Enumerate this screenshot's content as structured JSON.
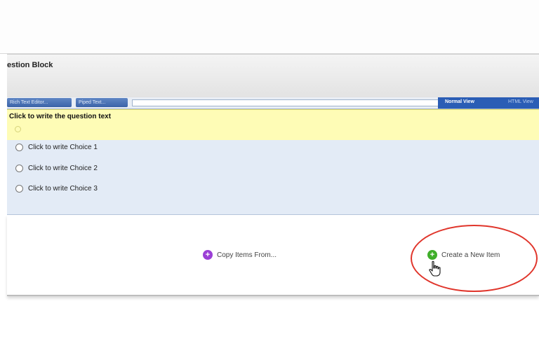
{
  "block": {
    "title": "estion Block"
  },
  "toolbar": {
    "rich_text_editor_label": "Rich Text Editor...",
    "piped_text_label": "Piped Text...",
    "normal_view_label": "Normal View",
    "html_view_label": "HTML View"
  },
  "question": {
    "prompt": "Click to write the question text",
    "choices": [
      {
        "label": "Click to write Choice 1"
      },
      {
        "label": "Click to write Choice 2"
      },
      {
        "label": "Click to write Choice 3"
      }
    ]
  },
  "actions": {
    "copy_items_label": "Copy Items From...",
    "create_item_label": "Create a New Item"
  },
  "colors": {
    "question_highlight": "#fefcb6",
    "choices_background": "#e3ebf6",
    "toolbar_blue": "#2a5db5",
    "copy_icon": "#9b3fd6",
    "create_icon": "#3fae2a",
    "annotation_circle": "#e0352b"
  },
  "icons": {
    "copy": "plus-circle-purple-icon",
    "create": "plus-circle-green-icon",
    "cursor": "hand-pointer-icon"
  }
}
